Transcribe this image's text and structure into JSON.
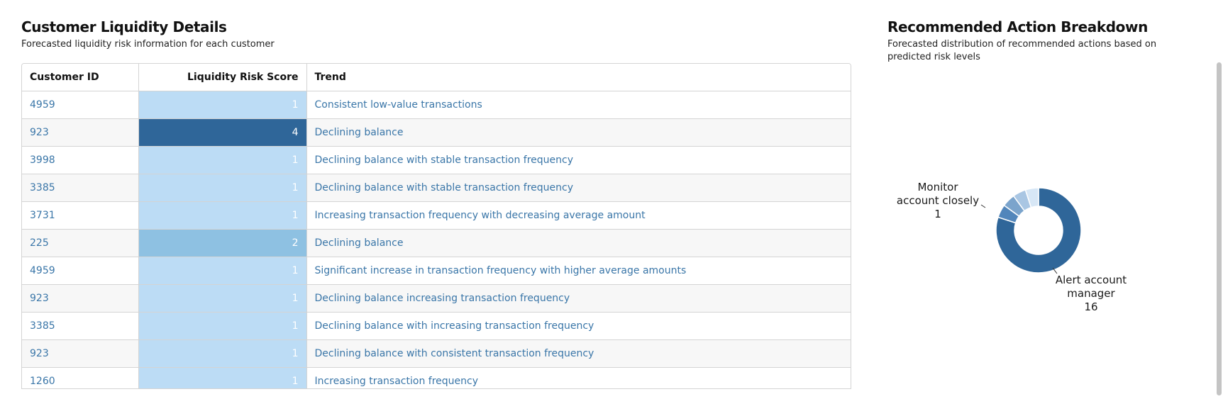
{
  "liquidity_panel": {
    "title": "Customer Liquidity Details",
    "subtitle": "Forecasted liquidity risk information for each customer",
    "columns": [
      "Customer ID",
      "Liquidity Risk Score",
      "Trend"
    ],
    "rows": [
      {
        "customer_id": "4959",
        "score": "1",
        "trend": "Consistent low-value transactions"
      },
      {
        "customer_id": "923",
        "score": "4",
        "trend": "Declining balance"
      },
      {
        "customer_id": "3998",
        "score": "1",
        "trend": "Declining balance with stable transaction frequency"
      },
      {
        "customer_id": "3385",
        "score": "1",
        "trend": "Declining balance with stable transaction frequency"
      },
      {
        "customer_id": "3731",
        "score": "1",
        "trend": "Increasing transaction frequency with decreasing average amount"
      },
      {
        "customer_id": "225",
        "score": "2",
        "trend": "Declining balance"
      },
      {
        "customer_id": "4959",
        "score": "1",
        "trend": "Significant increase in transaction frequency with higher average amounts"
      },
      {
        "customer_id": "923",
        "score": "1",
        "trend": "Declining balance increasing transaction frequency"
      },
      {
        "customer_id": "3385",
        "score": "1",
        "trend": "Declining balance with increasing transaction frequency"
      },
      {
        "customer_id": "923",
        "score": "1",
        "trend": "Declining balance with consistent transaction frequency"
      },
      {
        "customer_id": "1260",
        "score": "1",
        "trend": "Increasing transaction frequency"
      }
    ]
  },
  "action_panel": {
    "title": "Recommended Action Breakdown",
    "subtitle": "Forecasted distribution of recommended actions based on predicted risk levels"
  },
  "chart_data": {
    "type": "pie",
    "donut": true,
    "slices": [
      {
        "label": "Alert account manager",
        "value": 16,
        "color": "#2f6699"
      },
      {
        "label": "",
        "value": 1,
        "color": "#5286bb"
      },
      {
        "label": "",
        "value": 1,
        "color": "#7ba4cc"
      },
      {
        "label": "",
        "value": 1,
        "color": "#a9c6e3"
      },
      {
        "label": "Monitor account closely",
        "value": 1,
        "color": "#d7e7f6"
      }
    ],
    "labels": [
      {
        "lines": [
          "Monitor",
          "account closely",
          "1"
        ]
      },
      {
        "lines": [
          "Alert account",
          "manager",
          "16"
        ]
      }
    ]
  }
}
